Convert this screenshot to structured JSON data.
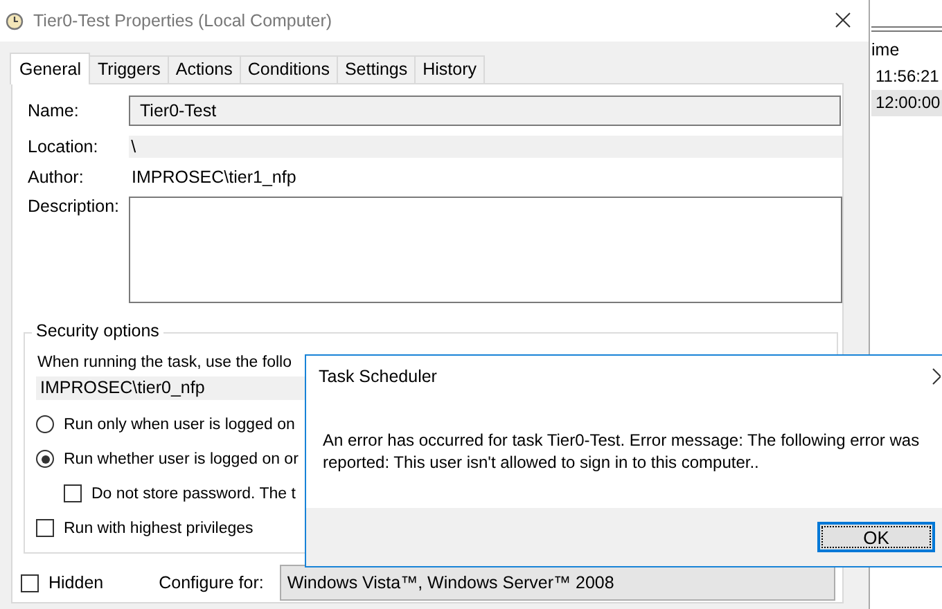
{
  "window": {
    "title": "Tier0-Test Properties (Local Computer)"
  },
  "tabs": [
    {
      "label": "General",
      "selected": true
    },
    {
      "label": "Triggers",
      "selected": false
    },
    {
      "label": "Actions",
      "selected": false
    },
    {
      "label": "Conditions",
      "selected": false
    },
    {
      "label": "Settings",
      "selected": false
    },
    {
      "label": "History",
      "selected": false
    }
  ],
  "general": {
    "name_label": "Name:",
    "name_value": "Tier0-Test",
    "location_label": "Location:",
    "location_value": "\\",
    "author_label": "Author:",
    "author_value": "IMPROSEC\\tier1_nfp",
    "description_label": "Description:"
  },
  "security_options": {
    "title": "Security options",
    "prompt": "When running the task, use the follo",
    "account": "IMPROSEC\\tier0_nfp",
    "options": [
      {
        "kind": "radio",
        "label": "Run only when user is logged on",
        "selected": false,
        "indented": false
      },
      {
        "kind": "radio",
        "label": "Run whether user is logged on or",
        "selected": true,
        "indented": false
      },
      {
        "kind": "checkbox",
        "label": "Do not store password.  The t",
        "checked": false,
        "indented": true
      },
      {
        "kind": "checkbox",
        "label": "Run with highest privileges",
        "checked": false,
        "indented": false
      }
    ]
  },
  "footer": {
    "hidden": {
      "label": "Hidden",
      "checked": false
    },
    "configure_label": "Configure for:",
    "configure_value": "Windows Vista™, Windows Server™ 2008"
  },
  "background_list": {
    "column_header": "ime",
    "rows": [
      {
        "text": "11:56:21",
        "selected": false
      },
      {
        "text": "12:00:00",
        "selected": true
      }
    ]
  },
  "dialog": {
    "title": "Task Scheduler",
    "message": "An error has occurred for task Tier0-Test. Error message: The following error was reported: This user isn't allowed to sign in to this computer..",
    "button": "OK"
  }
}
